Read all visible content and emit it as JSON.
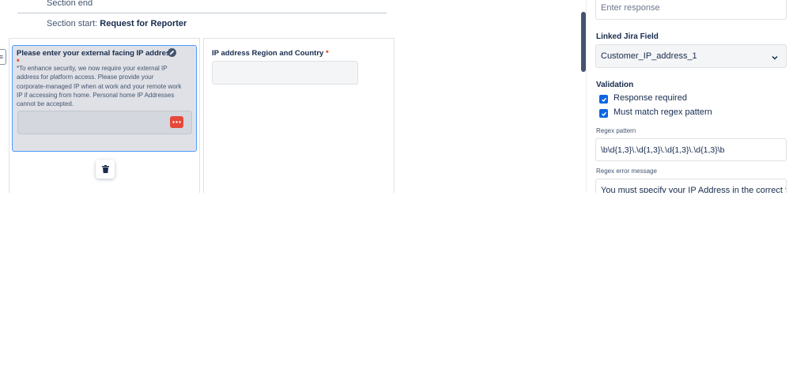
{
  "builder": {
    "section_end": "Section end",
    "section_start_prefix": "Section start:",
    "section_start_name": "Request for Reporter",
    "question1": {
      "label": "Please enter your external facing IP address",
      "required_mark": "*",
      "description": "*To enhance security, we now require your external IP address for platform access. Please provide your corporate-managed IP when at work and your remote work IP if accessing from home. Personal home IP Addresses cannot be accepted."
    },
    "question2": {
      "label": "IP address Region and Country",
      "required_mark": "*"
    }
  },
  "panel": {
    "response_placeholder": "Enter response",
    "linked_field_label": "Linked Jira Field",
    "linked_field_value": "Customer_IP_address_1",
    "validation_label": "Validation",
    "response_required_label": "Response required",
    "must_match_label": "Must match regex pattern",
    "regex_pattern_label": "Regex pattern",
    "regex_pattern_value": "\\b\\d{1,3}\\.\\d{1,3}\\.\\d{1,3}\\.\\d{1,3}\\b",
    "regex_error_label": "Regex error message",
    "regex_error_value": "You must specify your IP Address in the correct f"
  },
  "icons": {
    "drag": "drag-handle-icon",
    "edit": "pencil-icon",
    "more": "more-icon",
    "delete": "trash-icon",
    "chevron": "chevron-down-icon",
    "check": "checkmark-icon"
  },
  "colors": {
    "accent": "#0c66e4",
    "selected_border": "#4c9aff",
    "more_button": "#e5493a",
    "required": "#de350b"
  }
}
